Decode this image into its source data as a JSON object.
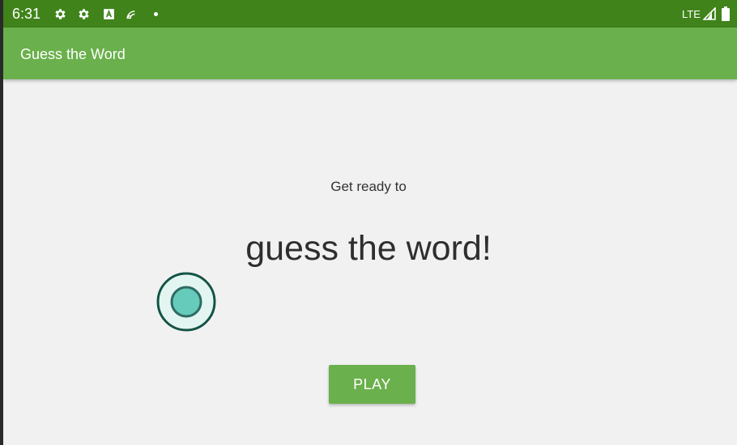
{
  "status_bar": {
    "time": "6:31",
    "network": "LTE",
    "icons": [
      "settings-gear-icon",
      "settings-gear-icon",
      "accessibility-a-icon",
      "cast-settings-icon",
      "notification-dot-icon",
      "signal-icon",
      "battery-icon"
    ]
  },
  "app_bar": {
    "title": "Guess the Word",
    "color": "#6ab04c"
  },
  "main": {
    "intro": "Get ready to",
    "headline": "guess the word!",
    "play_label": "PLAY"
  },
  "colors": {
    "status_bar": "#3f831a",
    "accent": "#6ab04c",
    "touch_indicator": "#66cbbb"
  }
}
